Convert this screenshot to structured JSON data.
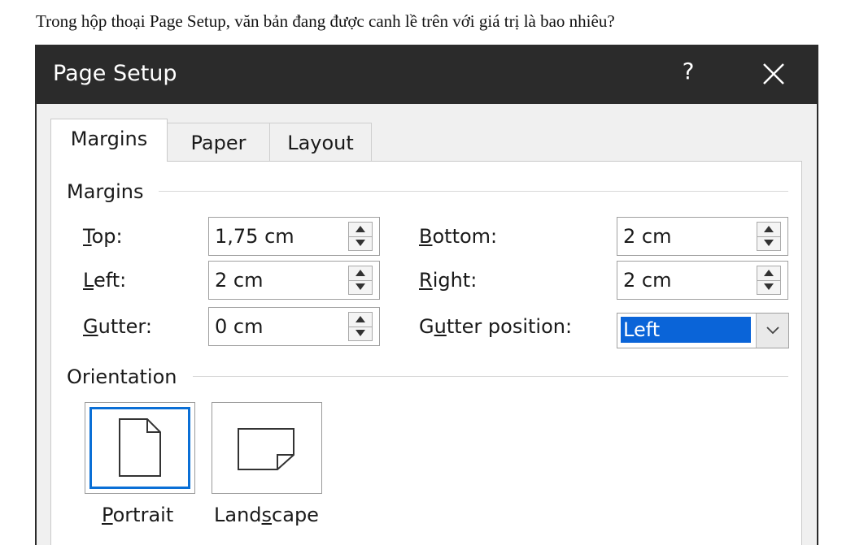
{
  "question": "Trong hộp thoại Page Setup, văn bản đang được canh lề trên với giá trị là bao nhiêu?",
  "dialog": {
    "title": "Page Setup",
    "help_glyph": "?",
    "icons": {
      "close": "close-icon",
      "spin": "spin-arrows-icon",
      "dropdown": "chevron-down-icon",
      "portrait": "portrait-page-icon",
      "landscape": "landscape-page-icon"
    },
    "tabs": [
      {
        "label": "Margins",
        "active": true
      },
      {
        "label": "Paper",
        "active": false
      },
      {
        "label": "Layout",
        "active": false
      }
    ],
    "margins": {
      "group_label": "Margins",
      "top": {
        "mnemonic": "T",
        "rest": "op:",
        "value": "1,75 cm"
      },
      "left": {
        "mnemonic": "L",
        "rest": "eft:",
        "value": "2 cm"
      },
      "gutter": {
        "mnemonic": "G",
        "rest": "utter:",
        "value": "0 cm"
      },
      "bottom": {
        "mnemonic": "B",
        "rest": "ottom:",
        "value": "2 cm"
      },
      "right": {
        "mnemonic": "R",
        "rest": "ight:",
        "value": "2 cm"
      },
      "gutter_position": {
        "pre": "G",
        "mnemonic": "u",
        "rest": "tter position:",
        "value": "Left"
      }
    },
    "orientation": {
      "group_label": "Orientation",
      "portrait": {
        "mnemonic": "P",
        "rest": "ortrait",
        "selected": true
      },
      "landscape": {
        "pre": "Land",
        "mnemonic": "s",
        "rest": "cape",
        "selected": false
      }
    }
  },
  "colors": {
    "titlebar": "#2b2b2b",
    "selection": "#0a64d8",
    "focus_border": "#0a6fd6"
  }
}
